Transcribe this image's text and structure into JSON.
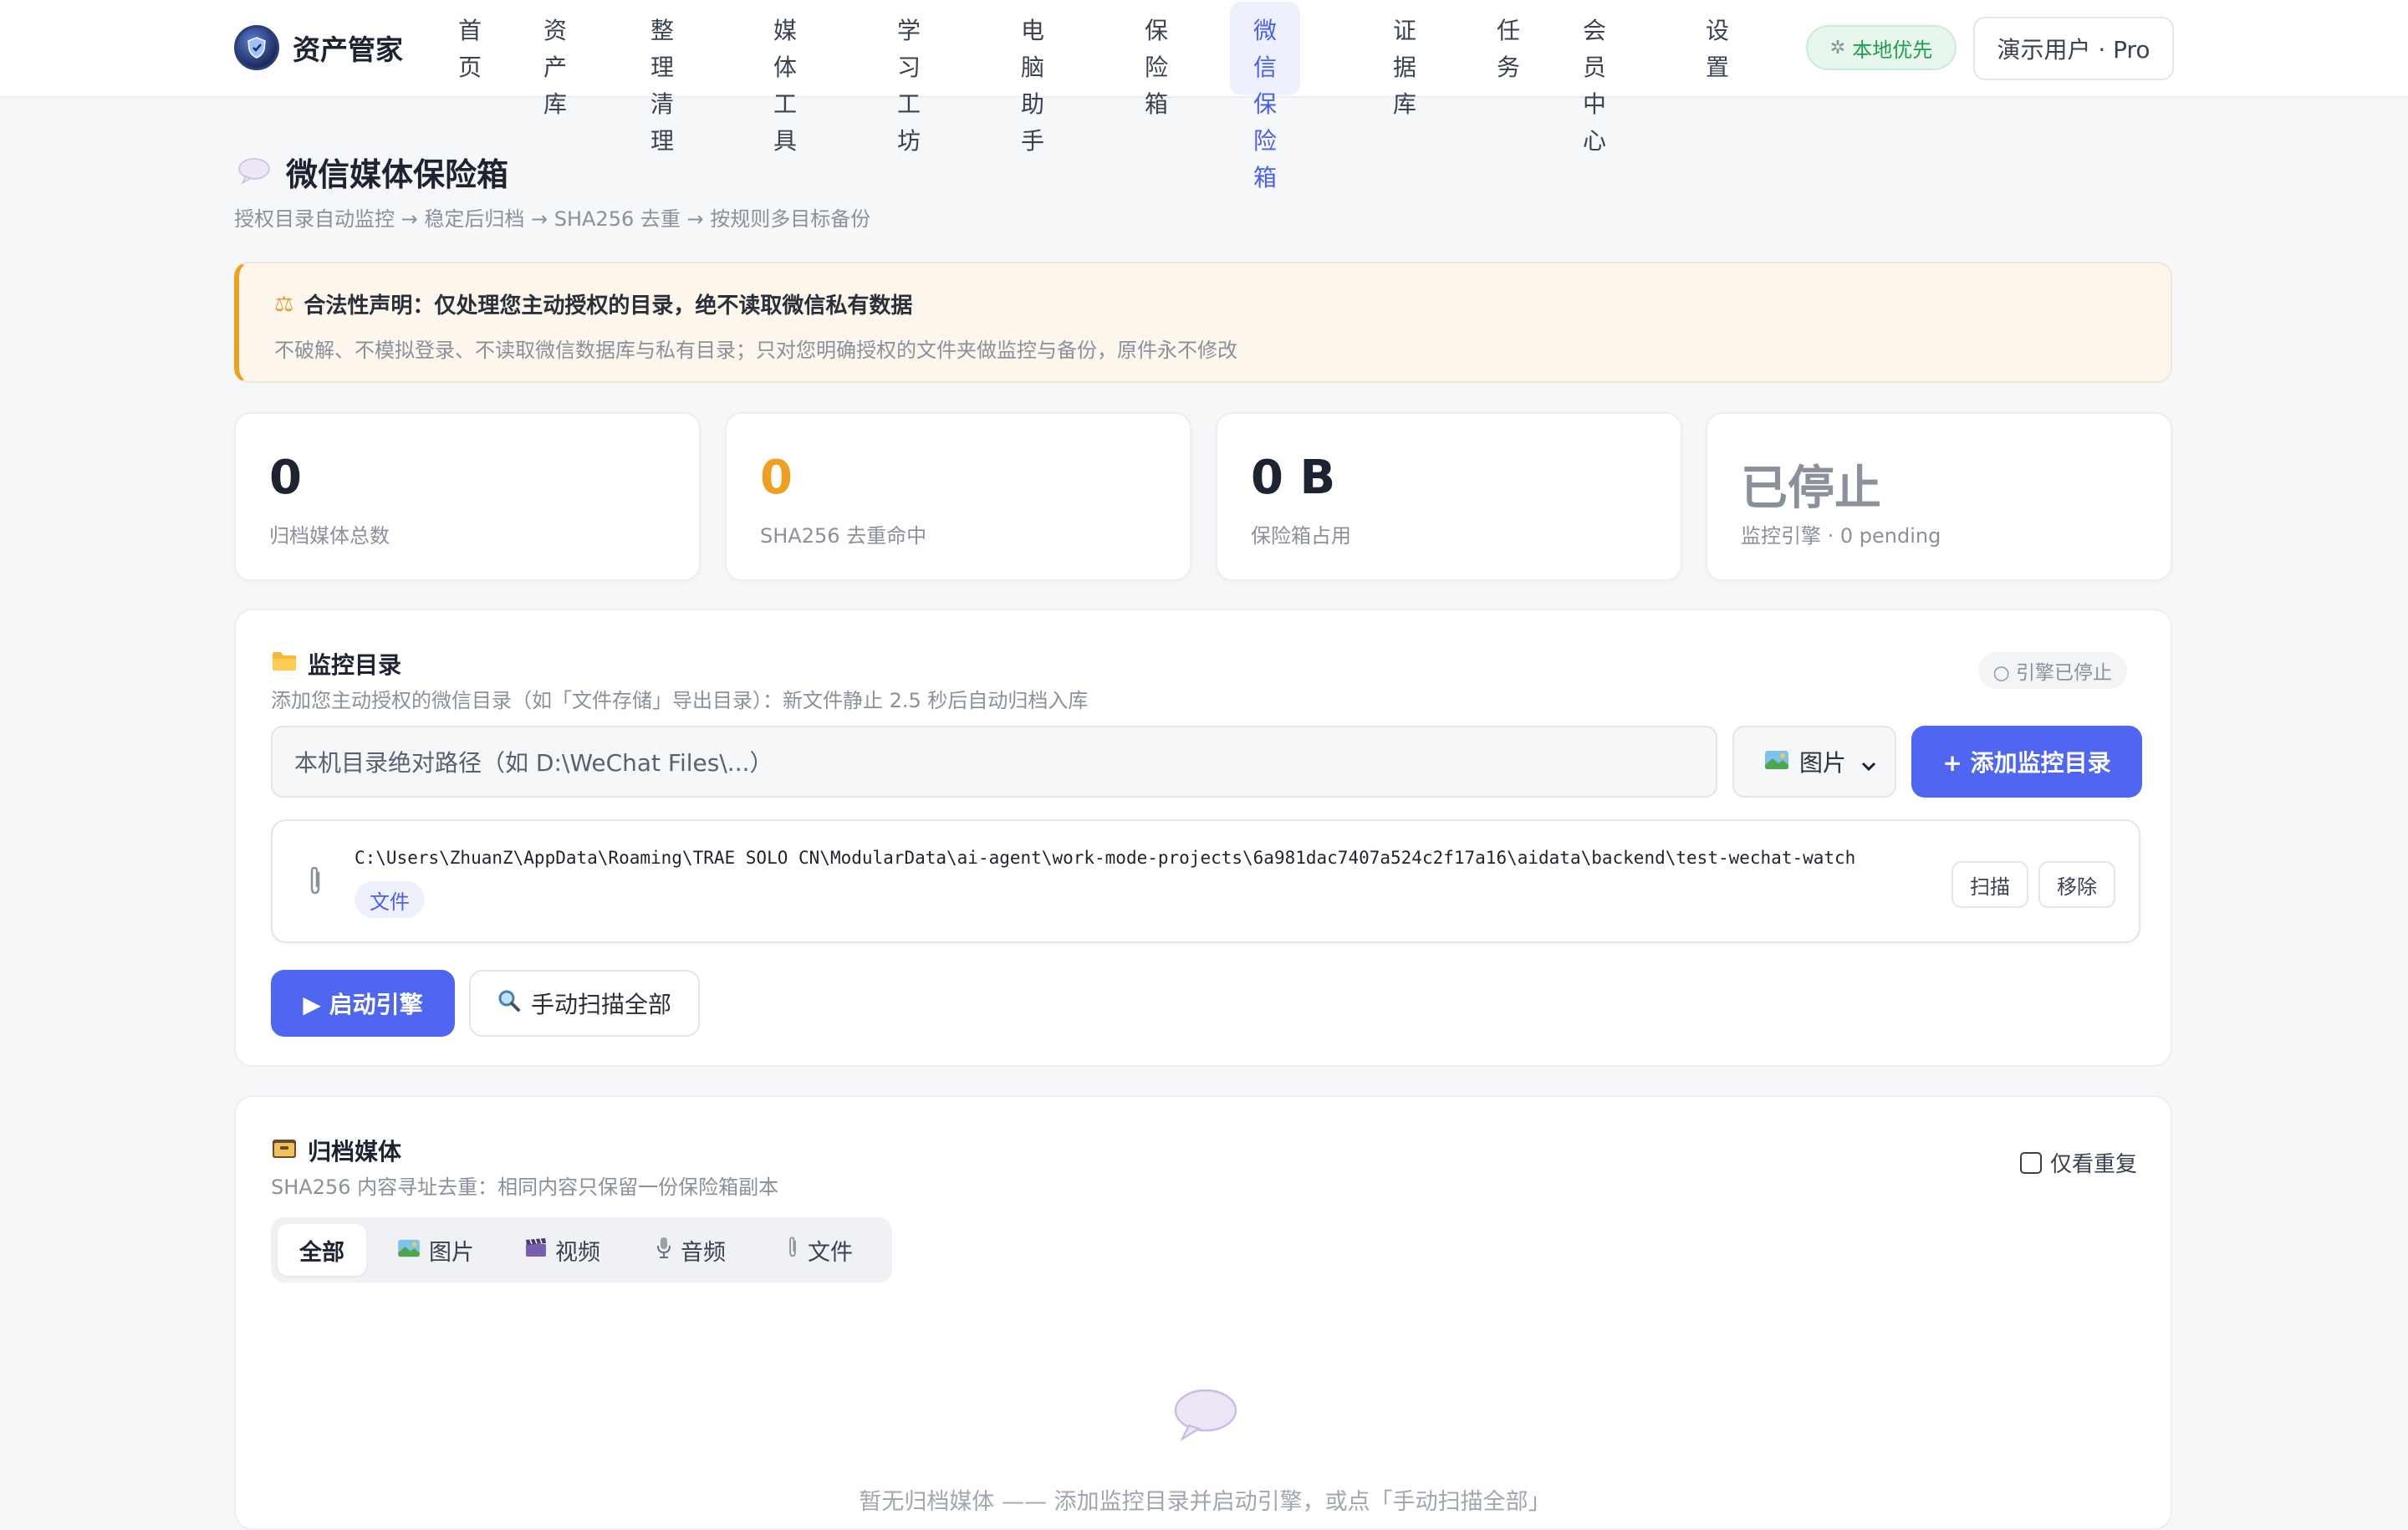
{
  "app": {
    "name": "资产管家"
  },
  "nav": {
    "items": [
      {
        "label": "首\n页"
      },
      {
        "label": "资产\n库"
      },
      {
        "label": "整理清\n理"
      },
      {
        "label": "媒体工\n具"
      },
      {
        "label": "学习工\n坊"
      },
      {
        "label": "电脑助\n手"
      },
      {
        "label": "保险\n箱"
      },
      {
        "label": "微信保\n险箱"
      },
      {
        "label": "证据\n库"
      },
      {
        "label": "任\n务"
      },
      {
        "label": "会员中\n心"
      },
      {
        "label": "设\n置"
      }
    ],
    "active_index": 7
  },
  "header": {
    "local_badge": "本地优先",
    "user_button": "演示用户 · Pro"
  },
  "page": {
    "title": "微信媒体保险箱",
    "subtitle": "授权目录自动监控 → 稳定后归档 → SHA256 去重 → 按规则多目标备份"
  },
  "notice": {
    "title": "合法性声明：仅处理您主动授权的目录，绝不读取微信私有数据",
    "body": "不破解、不模拟登录、不读取微信数据库与私有目录；只对您明确授权的文件夹做监控与备份，原件永不修改"
  },
  "stats": [
    {
      "value": "0",
      "label": "归档媒体总数",
      "color": "#1d2330"
    },
    {
      "value": "0",
      "label": "SHA256 去重命中",
      "color": "#f0a020"
    },
    {
      "value": "0 B",
      "label": "保险箱占用",
      "color": "#1d2330"
    },
    {
      "value": "已停止",
      "label": "监控引擎 · 0 pending",
      "color": "#8a909c"
    }
  ],
  "monitor": {
    "title": "监控目录",
    "subtitle": "添加您主动授权的微信目录（如「文件存储」导出目录）：新文件静止 2.5 秒后自动归档入库",
    "status_chip": "○ 引擎已停止",
    "path_placeholder": "本机目录绝对路径（如 D:\\WeChat Files\\...）",
    "type_selected": "图片",
    "add_button": "+ 添加监控目录",
    "directories": [
      {
        "path": "C:\\Users\\ZhuanZ\\AppData\\Roaming\\TRAE SOLO CN\\ModularData\\ai-agent\\work-mode-projects\\6a981dac7407a524c2f17a16\\aidata\\backend\\test-wechat-watch",
        "tag": "文件",
        "scan_label": "扫描",
        "remove_label": "移除"
      }
    ],
    "start_button": "▶ 启动引擎",
    "manual_scan_button": "手动扫描全部"
  },
  "archive": {
    "title": "归档媒体",
    "subtitle": "SHA256 内容寻址去重：相同内容只保留一份保险箱副本",
    "only_duplicates_label": "仅看重复",
    "tabs": [
      {
        "label": "全部",
        "icon": "none"
      },
      {
        "label": "图片",
        "icon": "image-icon"
      },
      {
        "label": "视频",
        "icon": "clapper-icon"
      },
      {
        "label": "音频",
        "icon": "mic-icon"
      },
      {
        "label": "文件",
        "icon": "paperclip-icon"
      }
    ],
    "active_tab": 0,
    "empty_text": "暂无归档媒体 —— 添加监控目录并启动引擎，或点「手动扫描全部」"
  },
  "colors": {
    "accent": "#4f66f0",
    "warning": "#f0a020",
    "success": "#1f9d55",
    "muted": "#8a909c"
  }
}
